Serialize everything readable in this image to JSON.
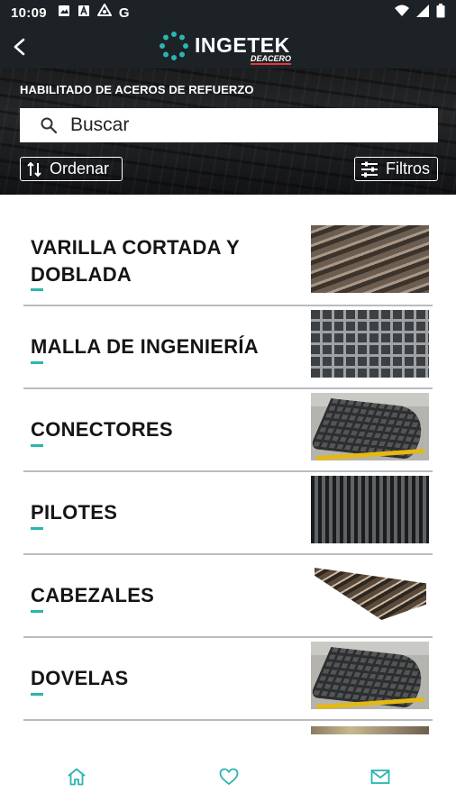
{
  "status_bar": {
    "time": "10:09",
    "left_icons": [
      "image-icon",
      "a-box-icon",
      "recycle-icon"
    ],
    "g_label": "G",
    "right_icons": [
      "wifi-icon",
      "signal-icon",
      "battery-icon"
    ]
  },
  "app_bar": {
    "brand": "INGETEK",
    "brand_sub": "DEACERO",
    "back_icon": "back-arrow-icon"
  },
  "hero": {
    "title": "HABILITADO DE ACEROS DE REFUERZO",
    "search_placeholder": "Buscar",
    "sort_label": "Ordenar",
    "filter_label": "Filtros"
  },
  "products": [
    {
      "name": "VARILLA CORTADA Y DOBLADA",
      "image": "rebar-bundle"
    },
    {
      "name": "MALLA DE INGENIERÍA",
      "image": "steel-mesh"
    },
    {
      "name": "CONECTORES",
      "image": "curved-cage"
    },
    {
      "name": "PILOTES",
      "image": "pile-cages"
    },
    {
      "name": "CABEZALES",
      "image": "rebar-bundle-angled"
    },
    {
      "name": "DOVELAS",
      "image": "curved-cage"
    }
  ],
  "bottom_nav": [
    {
      "icon": "home-icon",
      "active": true
    },
    {
      "icon": "heart-icon",
      "active": false
    },
    {
      "icon": "mail-icon",
      "active": false
    }
  ],
  "colors": {
    "bar": "#1d2226",
    "accent": "#2bb5b0",
    "text": "#151515",
    "divider": "#b9bcbf"
  }
}
